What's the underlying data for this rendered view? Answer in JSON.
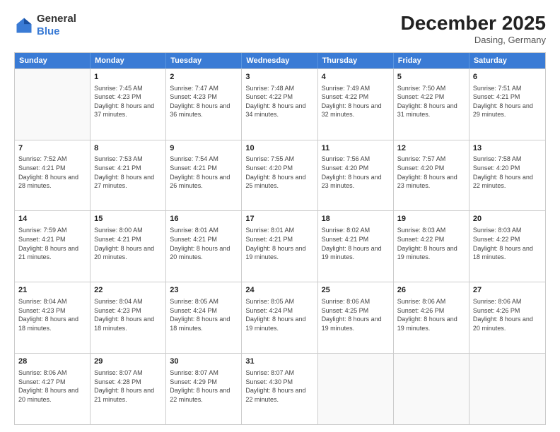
{
  "header": {
    "logo_general": "General",
    "logo_blue": "Blue",
    "month_title": "December 2025",
    "location": "Dasing, Germany"
  },
  "days_of_week": [
    "Sunday",
    "Monday",
    "Tuesday",
    "Wednesday",
    "Thursday",
    "Friday",
    "Saturday"
  ],
  "weeks": [
    [
      {
        "day": "",
        "sunrise": "",
        "sunset": "",
        "daylight": ""
      },
      {
        "day": "1",
        "sunrise": "Sunrise: 7:45 AM",
        "sunset": "Sunset: 4:23 PM",
        "daylight": "Daylight: 8 hours and 37 minutes."
      },
      {
        "day": "2",
        "sunrise": "Sunrise: 7:47 AM",
        "sunset": "Sunset: 4:23 PM",
        "daylight": "Daylight: 8 hours and 36 minutes."
      },
      {
        "day": "3",
        "sunrise": "Sunrise: 7:48 AM",
        "sunset": "Sunset: 4:22 PM",
        "daylight": "Daylight: 8 hours and 34 minutes."
      },
      {
        "day": "4",
        "sunrise": "Sunrise: 7:49 AM",
        "sunset": "Sunset: 4:22 PM",
        "daylight": "Daylight: 8 hours and 32 minutes."
      },
      {
        "day": "5",
        "sunrise": "Sunrise: 7:50 AM",
        "sunset": "Sunset: 4:22 PM",
        "daylight": "Daylight: 8 hours and 31 minutes."
      },
      {
        "day": "6",
        "sunrise": "Sunrise: 7:51 AM",
        "sunset": "Sunset: 4:21 PM",
        "daylight": "Daylight: 8 hours and 29 minutes."
      }
    ],
    [
      {
        "day": "7",
        "sunrise": "Sunrise: 7:52 AM",
        "sunset": "Sunset: 4:21 PM",
        "daylight": "Daylight: 8 hours and 28 minutes."
      },
      {
        "day": "8",
        "sunrise": "Sunrise: 7:53 AM",
        "sunset": "Sunset: 4:21 PM",
        "daylight": "Daylight: 8 hours and 27 minutes."
      },
      {
        "day": "9",
        "sunrise": "Sunrise: 7:54 AM",
        "sunset": "Sunset: 4:21 PM",
        "daylight": "Daylight: 8 hours and 26 minutes."
      },
      {
        "day": "10",
        "sunrise": "Sunrise: 7:55 AM",
        "sunset": "Sunset: 4:20 PM",
        "daylight": "Daylight: 8 hours and 25 minutes."
      },
      {
        "day": "11",
        "sunrise": "Sunrise: 7:56 AM",
        "sunset": "Sunset: 4:20 PM",
        "daylight": "Daylight: 8 hours and 23 minutes."
      },
      {
        "day": "12",
        "sunrise": "Sunrise: 7:57 AM",
        "sunset": "Sunset: 4:20 PM",
        "daylight": "Daylight: 8 hours and 23 minutes."
      },
      {
        "day": "13",
        "sunrise": "Sunrise: 7:58 AM",
        "sunset": "Sunset: 4:20 PM",
        "daylight": "Daylight: 8 hours and 22 minutes."
      }
    ],
    [
      {
        "day": "14",
        "sunrise": "Sunrise: 7:59 AM",
        "sunset": "Sunset: 4:21 PM",
        "daylight": "Daylight: 8 hours and 21 minutes."
      },
      {
        "day": "15",
        "sunrise": "Sunrise: 8:00 AM",
        "sunset": "Sunset: 4:21 PM",
        "daylight": "Daylight: 8 hours and 20 minutes."
      },
      {
        "day": "16",
        "sunrise": "Sunrise: 8:01 AM",
        "sunset": "Sunset: 4:21 PM",
        "daylight": "Daylight: 8 hours and 20 minutes."
      },
      {
        "day": "17",
        "sunrise": "Sunrise: 8:01 AM",
        "sunset": "Sunset: 4:21 PM",
        "daylight": "Daylight: 8 hours and 19 minutes."
      },
      {
        "day": "18",
        "sunrise": "Sunrise: 8:02 AM",
        "sunset": "Sunset: 4:21 PM",
        "daylight": "Daylight: 8 hours and 19 minutes."
      },
      {
        "day": "19",
        "sunrise": "Sunrise: 8:03 AM",
        "sunset": "Sunset: 4:22 PM",
        "daylight": "Daylight: 8 hours and 19 minutes."
      },
      {
        "day": "20",
        "sunrise": "Sunrise: 8:03 AM",
        "sunset": "Sunset: 4:22 PM",
        "daylight": "Daylight: 8 hours and 18 minutes."
      }
    ],
    [
      {
        "day": "21",
        "sunrise": "Sunrise: 8:04 AM",
        "sunset": "Sunset: 4:23 PM",
        "daylight": "Daylight: 8 hours and 18 minutes."
      },
      {
        "day": "22",
        "sunrise": "Sunrise: 8:04 AM",
        "sunset": "Sunset: 4:23 PM",
        "daylight": "Daylight: 8 hours and 18 minutes."
      },
      {
        "day": "23",
        "sunrise": "Sunrise: 8:05 AM",
        "sunset": "Sunset: 4:24 PM",
        "daylight": "Daylight: 8 hours and 18 minutes."
      },
      {
        "day": "24",
        "sunrise": "Sunrise: 8:05 AM",
        "sunset": "Sunset: 4:24 PM",
        "daylight": "Daylight: 8 hours and 19 minutes."
      },
      {
        "day": "25",
        "sunrise": "Sunrise: 8:06 AM",
        "sunset": "Sunset: 4:25 PM",
        "daylight": "Daylight: 8 hours and 19 minutes."
      },
      {
        "day": "26",
        "sunrise": "Sunrise: 8:06 AM",
        "sunset": "Sunset: 4:26 PM",
        "daylight": "Daylight: 8 hours and 19 minutes."
      },
      {
        "day": "27",
        "sunrise": "Sunrise: 8:06 AM",
        "sunset": "Sunset: 4:26 PM",
        "daylight": "Daylight: 8 hours and 20 minutes."
      }
    ],
    [
      {
        "day": "28",
        "sunrise": "Sunrise: 8:06 AM",
        "sunset": "Sunset: 4:27 PM",
        "daylight": "Daylight: 8 hours and 20 minutes."
      },
      {
        "day": "29",
        "sunrise": "Sunrise: 8:07 AM",
        "sunset": "Sunset: 4:28 PM",
        "daylight": "Daylight: 8 hours and 21 minutes."
      },
      {
        "day": "30",
        "sunrise": "Sunrise: 8:07 AM",
        "sunset": "Sunset: 4:29 PM",
        "daylight": "Daylight: 8 hours and 22 minutes."
      },
      {
        "day": "31",
        "sunrise": "Sunrise: 8:07 AM",
        "sunset": "Sunset: 4:30 PM",
        "daylight": "Daylight: 8 hours and 22 minutes."
      },
      {
        "day": "",
        "sunrise": "",
        "sunset": "",
        "daylight": ""
      },
      {
        "day": "",
        "sunrise": "",
        "sunset": "",
        "daylight": ""
      },
      {
        "day": "",
        "sunrise": "",
        "sunset": "",
        "daylight": ""
      }
    ]
  ]
}
